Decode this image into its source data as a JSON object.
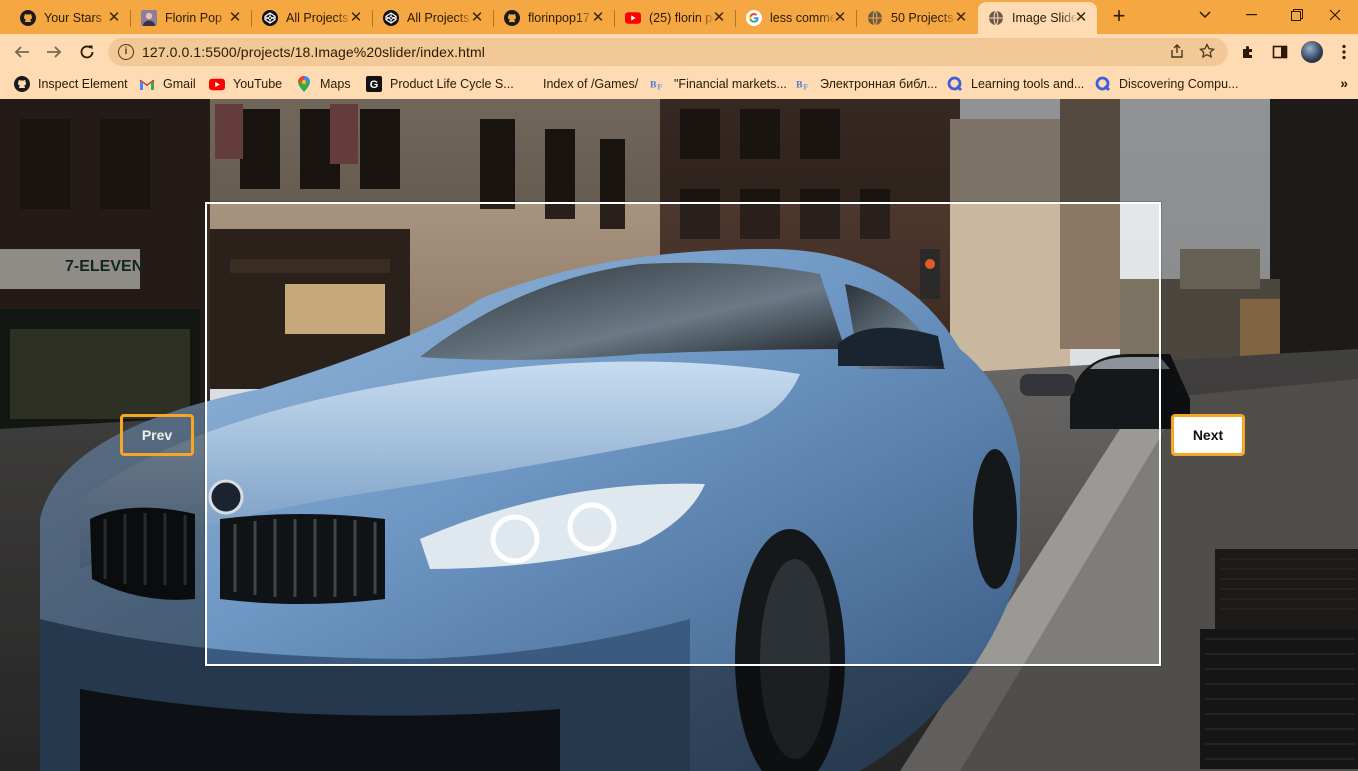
{
  "browser": {
    "tabs": [
      {
        "title": "Your Stars",
        "icon": "github-icon"
      },
      {
        "title": "Florin Pop",
        "icon": "avatar-icon"
      },
      {
        "title": "All Projects",
        "icon": "codepen-icon"
      },
      {
        "title": "All Projects",
        "icon": "codepen-icon"
      },
      {
        "title": "florinpop17",
        "icon": "github-icon"
      },
      {
        "title": "(25) florin pop",
        "icon": "youtube-icon"
      },
      {
        "title": "less comments",
        "icon": "google-icon"
      },
      {
        "title": "50 Projects",
        "icon": "globe-icon"
      },
      {
        "title": "Image Slider",
        "icon": "globe-icon",
        "active": true
      }
    ],
    "address": {
      "url": "127.0.0.1:5500/projects/18.Image%20slider/index.html"
    },
    "bookmarks": [
      {
        "label": "Inspect Element",
        "icon": "github-icon"
      },
      {
        "label": "Gmail",
        "icon": "gmail-icon"
      },
      {
        "label": "YouTube",
        "icon": "youtube-icon"
      },
      {
        "label": "Maps",
        "icon": "maps-pin-icon"
      },
      {
        "label": "Product Life Cycle S...",
        "icon": "g-square-icon"
      },
      {
        "label": "Index of /Games/",
        "icon": "none"
      },
      {
        "label": "\"Financial markets...",
        "icon": "bf-icon"
      },
      {
        "label": "Электронная библ...",
        "icon": "bf-icon"
      },
      {
        "label": "Learning tools and...",
        "icon": "q-icon"
      },
      {
        "label": "Discovering Compu...",
        "icon": "q-icon"
      }
    ]
  },
  "page": {
    "prev_label": "Prev",
    "next_label": "Next"
  },
  "colors": {
    "tabstrip": "#f5a742",
    "toolbar": "#fedbb2",
    "button_border": "#f5a623"
  }
}
